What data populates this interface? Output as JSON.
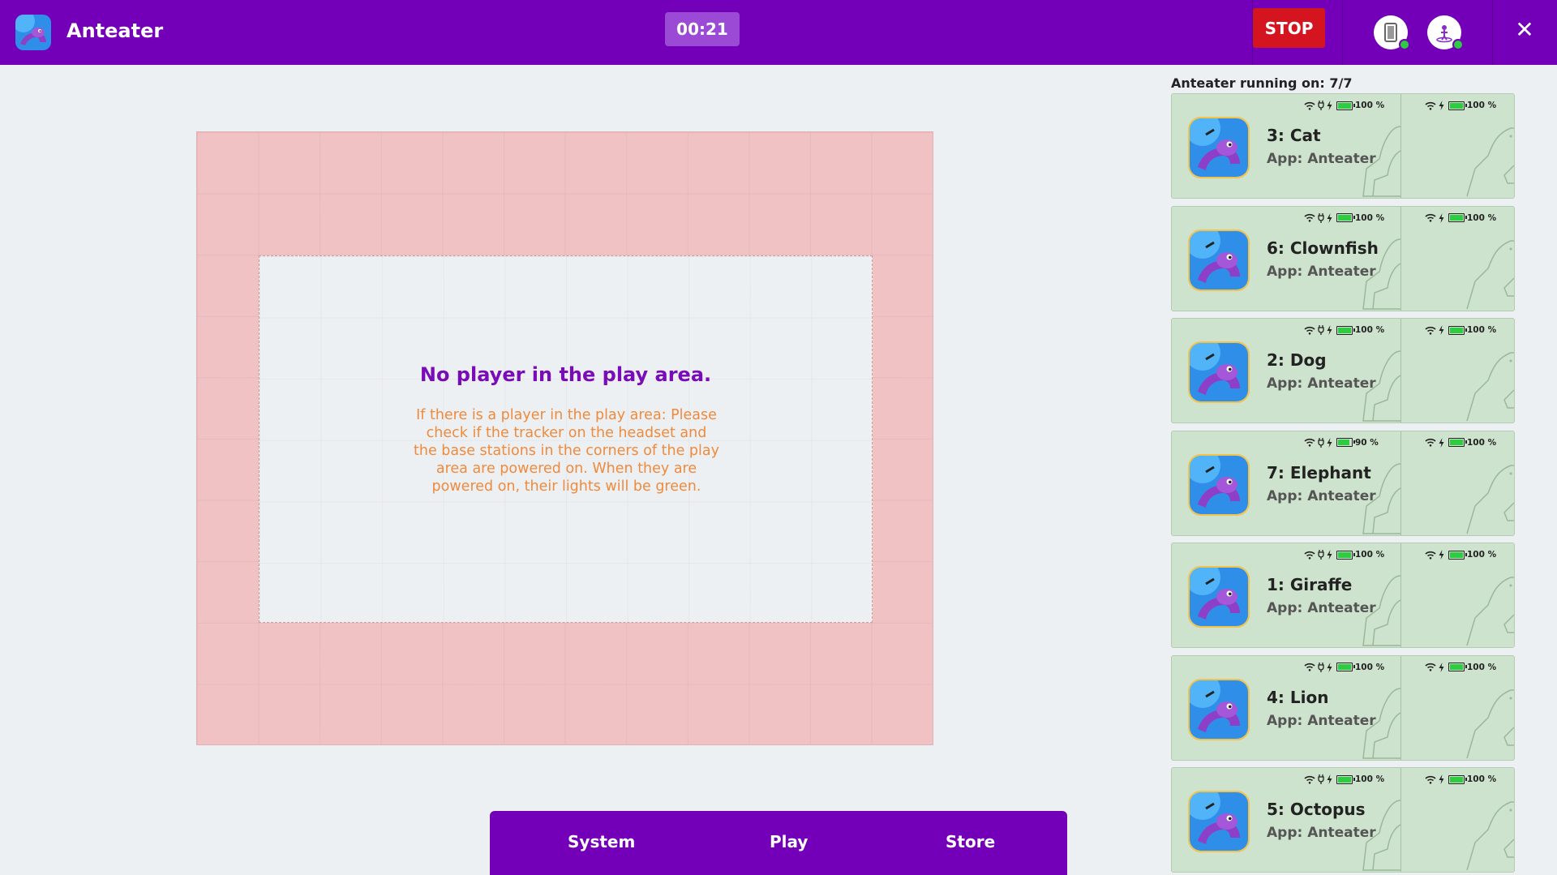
{
  "header": {
    "app_title": "Anteater",
    "timer": "00:21",
    "stop_label": "STOP",
    "close_symbol": "✕",
    "icons": [
      "anteater-app-icon",
      "headset-status-icon",
      "player-status-icon",
      "close-icon"
    ],
    "colors": {
      "bar": "#7300b8",
      "stop": "#d4141e",
      "status_ok": "#2ecc40"
    }
  },
  "play_area": {
    "title": "No player in the play area.",
    "message": "If there is a player in the play area: Please check if the tracker on the headset and the base stations in the corners of the play area are powered on. When they are powered on, their lights will be green.",
    "colors": {
      "boundary": "#f0c2c4",
      "title": "#7a0cb8",
      "message": "#f08a3c"
    }
  },
  "nav": {
    "system": "System",
    "play": "Play",
    "store": "Store"
  },
  "devices_panel": {
    "running_label": "Anteater running on: 7/7",
    "devices": [
      {
        "name": "3: Cat",
        "app": "App: Anteater",
        "headset_battery": "100 %",
        "headset_charge": 1.0,
        "controller_battery": "100 %",
        "controller_charge": 1.0
      },
      {
        "name": "6: Clownfish",
        "app": "App: Anteater",
        "headset_battery": "100 %",
        "headset_charge": 1.0,
        "controller_battery": "100 %",
        "controller_charge": 1.0
      },
      {
        "name": "2: Dog",
        "app": "App: Anteater",
        "headset_battery": "100 %",
        "headset_charge": 1.0,
        "controller_battery": "100 %",
        "controller_charge": 1.0
      },
      {
        "name": "7: Elephant",
        "app": "App: Anteater",
        "headset_battery": "90 %",
        "headset_charge": 0.9,
        "controller_battery": "100 %",
        "controller_charge": 1.0
      },
      {
        "name": "1: Giraffe",
        "app": "App: Anteater",
        "headset_battery": "100 %",
        "headset_charge": 1.0,
        "controller_battery": "100 %",
        "controller_charge": 1.0
      },
      {
        "name": "4: Lion",
        "app": "App: Anteater",
        "headset_battery": "100 %",
        "headset_charge": 1.0,
        "controller_battery": "100 %",
        "controller_charge": 1.0
      },
      {
        "name": "5: Octopus",
        "app": "App: Anteater",
        "headset_battery": "100 %",
        "headset_charge": 1.0,
        "controller_battery": "100 %",
        "controller_charge": 1.0
      }
    ]
  }
}
